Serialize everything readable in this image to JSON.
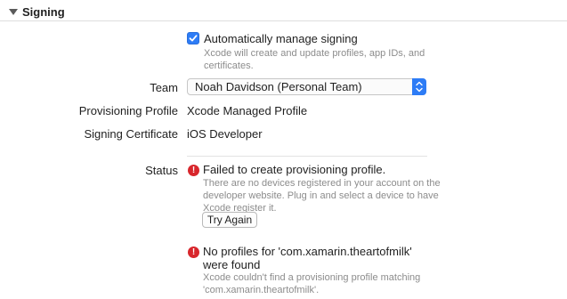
{
  "section": {
    "title": "Signing"
  },
  "auto_signing": {
    "checked": true,
    "label": "Automatically manage signing",
    "hint": "Xcode will create and update profiles, app IDs, and certificates."
  },
  "team": {
    "label": "Team",
    "selected": "Noah Davidson (Personal Team)"
  },
  "provisioning_profile": {
    "label": "Provisioning Profile",
    "value": "Xcode Managed Profile"
  },
  "signing_certificate": {
    "label": "Signing Certificate",
    "value": "iOS Developer"
  },
  "status": {
    "label": "Status",
    "errors": [
      {
        "title": "Failed to create provisioning profile.",
        "description": "There are no devices registered in your account on the developer website. Plug in and select a device to have Xcode register it.",
        "button": "Try Again"
      },
      {
        "title": "No profiles for 'com.xamarin.theartofmilk' were found",
        "description": "Xcode couldn't find a provisioning profile matching 'com.xamarin.theartofmilk'."
      }
    ]
  },
  "colors": {
    "accent": "#2d7cf6",
    "error": "#d8262c",
    "hint_text": "#8c8c8c"
  }
}
